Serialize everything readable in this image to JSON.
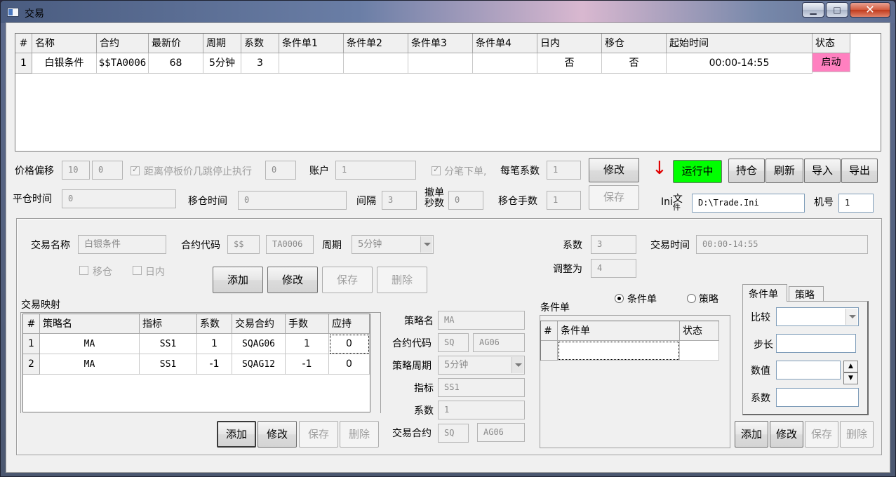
{
  "window": {
    "title": "交易",
    "min": "▁",
    "max": "□",
    "close": "✕"
  },
  "top_table": {
    "headers": [
      "#",
      "名称",
      "合约",
      "最新价",
      "周期",
      "系数",
      "条件单1",
      "条件单2",
      "条件单3",
      "条件单4",
      "日内",
      "移仓",
      "起始时间",
      "状态"
    ],
    "rows": [
      [
        "1",
        "白银条件",
        "$$TA0006",
        "68",
        "5分钟",
        "3",
        "",
        "",
        "",
        "",
        "否",
        "否",
        "00:00-14:55",
        "启动"
      ]
    ],
    "status_color": "#ff80c0"
  },
  "params": {
    "price_offset_label": "价格偏移",
    "price_offset_1": "10",
    "price_offset_2": "0",
    "stop_exec_label": "距离停板价几跳停止执行",
    "stop_exec_value": "0",
    "account_label": "账户",
    "account_value": "1",
    "split_order_label": "分笔下单,",
    "per_lot_label": "每笔系数",
    "per_lot_value": "1",
    "close_time_label": "平仓时间",
    "close_time_value": "0",
    "roll_time_label": "移仓时间",
    "roll_time_value": "0",
    "interval_label": "间隔",
    "interval_value": "3",
    "cancel_sec_label_1": "撤单",
    "cancel_sec_label_2": "秒数",
    "cancel_sec_value": "0",
    "roll_lots_label": "移仓手数",
    "roll_lots_value": "1",
    "modify_label": "修改",
    "save_label": "保存",
    "ini_label": "Ini文件",
    "ini_label_1": "Ini",
    "ini_label_2": "文",
    "ini_label_3": "件",
    "ini_value": "D:\\Trade.Ini",
    "machine_label": "机号",
    "machine_value": "1"
  },
  "toolbar": {
    "arrow": "↓",
    "running": "运行中",
    "running_color": "#00ff00",
    "position": "持仓",
    "refresh": "刷新",
    "import": "导入",
    "export": "导出"
  },
  "trade": {
    "name_label": "交易名称",
    "name_value": "白银条件",
    "code_label": "合约代码",
    "code_prefix": "$$",
    "code_value": "TA0006",
    "period_label": "周期",
    "period_value": "5分钟",
    "coef_label": "系数",
    "coef_value": "3",
    "time_label": "交易时间",
    "time_value": "00:00-14:55",
    "adjust_label": "调整为",
    "adjust_value": "4",
    "roll_label": "移仓",
    "intraday_label": "日内",
    "add": "添加",
    "modify": "修改",
    "save": "保存",
    "delete": "删除"
  },
  "mapping": {
    "title": "交易映射",
    "headers": [
      "#",
      "策略名",
      "指标",
      "系数",
      "交易合约",
      "手数",
      "应持"
    ],
    "rows": [
      [
        "1",
        "MA",
        "SS1",
        "1",
        "SQAG06",
        "1",
        "0"
      ],
      [
        "2",
        "MA",
        "SS1",
        "-1",
        "SQAG12",
        "-1",
        "0"
      ]
    ],
    "add": "添加",
    "modify": "修改",
    "save": "保存",
    "delete": "删除"
  },
  "strategy": {
    "name_label": "策略名",
    "name_value": "MA",
    "code_label": "合约代码",
    "code_prefix": "SQ",
    "code_value": "AG06",
    "period_label": "策略周期",
    "period_value": "5分钟",
    "indicator_label": "指标",
    "indicator_value": "SS1",
    "coef_label": "系数",
    "coef_value": "1",
    "trade_code_label": "交易合约",
    "trade_prefix": "SQ",
    "trade_value": "AG06"
  },
  "condition": {
    "title": "条件单",
    "radio_condition": "条件单",
    "radio_strategy": "策略",
    "headers": [
      "#",
      "条件单",
      "状态"
    ],
    "tab_condition": "条件单",
    "tab_strategy": "策略",
    "compare_label": "比较",
    "step_label": "步长",
    "value_label": "数值",
    "coef_label": "系数",
    "add": "添加",
    "modify": "修改",
    "save": "保存",
    "delete": "删除"
  }
}
